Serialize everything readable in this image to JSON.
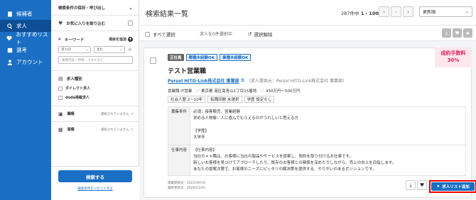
{
  "nav": {
    "items": [
      {
        "label": "候補者",
        "icon": "document-icon"
      },
      {
        "label": "求人",
        "icon": "search-icon"
      },
      {
        "label": "おすすめリスト",
        "icon": "heart-icon"
      },
      {
        "label": "選考",
        "icon": "table-icon"
      },
      {
        "label": "アカウント",
        "icon": "person-icon"
      }
    ],
    "active_index": 1
  },
  "filter": {
    "saved_conditions_label": "検索条件の保存・呼び出し",
    "favorites_label": "お気に入りを絞り込む",
    "keyword": {
      "title": "キーワード",
      "add_label": "項目を追加",
      "select1": "求人ID",
      "select2": "含む",
      "placeholder": "業務内容・特徴、スキルなど"
    },
    "job_type": {
      "title": "求人種別",
      "options": [
        "ダイレクト求人",
        "doda掲載求人"
      ]
    },
    "occupation": {
      "title": "職種",
      "value": "選択されていません"
    },
    "industry": {
      "title": "業種",
      "value": "選択されていません"
    },
    "search_button": "検索する",
    "reset_link": "検索条件をリセットする"
  },
  "header": {
    "title": "検索結果一覧",
    "count_total": "287件中",
    "count_range": "1 - 100件",
    "sort": "更新順"
  },
  "actionbar": {
    "select_all": "すべて選択",
    "selected_info": "求人を0件選択中",
    "clear": "選択解除"
  },
  "job": {
    "tags": [
      "正社員",
      "職種未経験OK",
      "業種未経験OK"
    ],
    "ribbon": [
      "成約手数料",
      "30%"
    ],
    "title": "テスト営業職",
    "company": "Persol HITO-Link株式会社 事業部",
    "provider": "（求人提供元：Persol HITO-Link株式会社 事業部）",
    "meta": "営業職 IT営業　／ 東京都 港区南青山1丁目15番地　／ 450万円〜500万円",
    "chips": [
      "社会人歴 2〜10年",
      "転職回数 未選択",
      "学歴 設定なし"
    ],
    "req_label": "募集条件",
    "req_lines": [
      "必須：接客販売、営業経験",
      "求める人物像：人に喜んでもらえるのがうれしいと思える方",
      "",
      "【学歴】",
      "大学卒"
    ],
    "desc_label": "仕事内容",
    "desc_lines": [
      "【仕事内容】",
      "当社の＊＊職は、お客様に当社の製品やサービスを提案し、契約を取り付けるお仕事です。",
      "新しいお客様を見つけてアプローチしたり、既存のお客様との関係を深めたりしながら、売上の向上を目指します。",
      "あなたの提案次第で、お客様のニーズにピッタリの解決策を提供する、やりがいのあるポジションです。"
    ],
    "posted": "掲載開始日：2025/09/18",
    "updated": "最終更新日：2026/01/05",
    "add_list_button": "求人リスト追加"
  }
}
